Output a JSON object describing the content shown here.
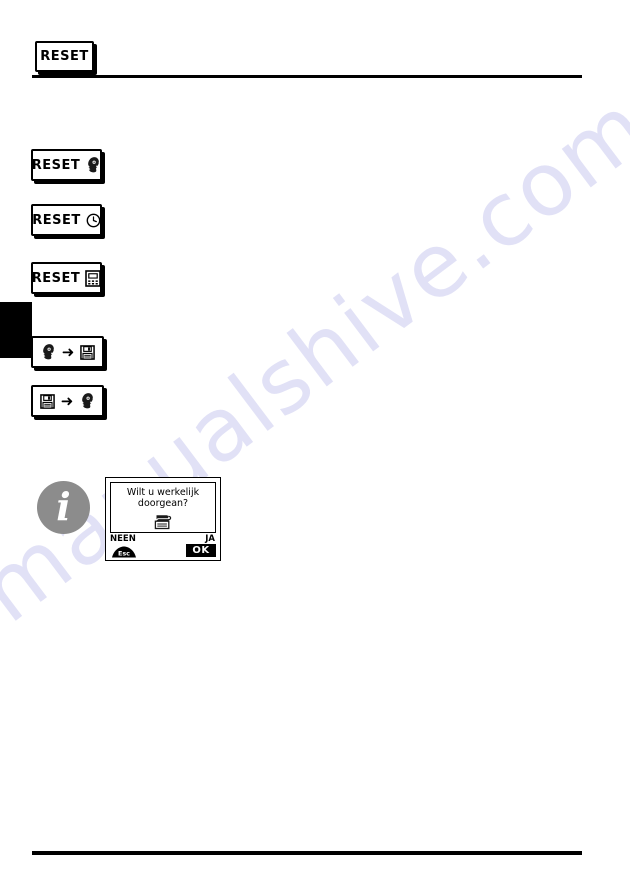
{
  "page": {
    "language": "nl",
    "watermark_text": "manualshive.com",
    "watermark_color": "#c9c9ef"
  },
  "keys": [
    {
      "id": "reset-plain",
      "label": "RESET",
      "icon": null,
      "icon_name": null
    },
    {
      "id": "reset-user",
      "label": "RESET",
      "icon": "person-head-icon",
      "icon_name": "person-head-icon"
    },
    {
      "id": "reset-clock",
      "label": "RESET",
      "icon": "clock-icon",
      "icon_name": "clock-icon"
    },
    {
      "id": "reset-device",
      "label": "RESET",
      "icon": "device-display-icon",
      "icon_name": "device-display-icon"
    },
    {
      "id": "user-to-save",
      "label": "",
      "icon": "person-head-to-floppy",
      "icon_name": "person-head-icon",
      "arrow": "➜",
      "icon_right_name": "floppy-disk-icon"
    },
    {
      "id": "save-to-user",
      "label": "",
      "icon": "floppy-to-person-head",
      "icon_name": "floppy-disk-icon",
      "arrow": "➜",
      "icon_right_name": "person-head-icon"
    }
  ],
  "info_block": {
    "info_glyph": "i",
    "info_icon_color": "#8c8c8c"
  },
  "dialog": {
    "message_line1": "Wilt u werkelijk",
    "message_line2": "doorgean?",
    "center_icon_name": "save-to-device-icon",
    "softkey_left_label": "NEEN",
    "softkey_left_button": "Esc",
    "softkey_right_label": "JA",
    "softkey_right_button": "OK"
  }
}
